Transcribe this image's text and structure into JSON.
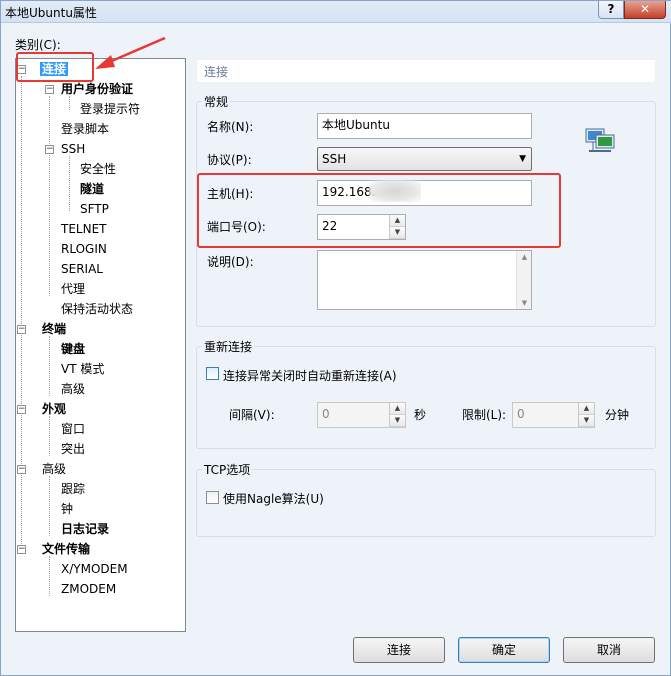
{
  "window": {
    "title": "本地Ubuntu属性",
    "help_label": "?",
    "close_label": "✕"
  },
  "category_label": "类别(C):",
  "tree": {
    "nodes": [
      {
        "label": "连接"
      },
      {
        "label": "用户身份验证"
      },
      {
        "label": "登录提示符"
      },
      {
        "label": "登录脚本"
      },
      {
        "label": "SSH"
      },
      {
        "label": "安全性"
      },
      {
        "label": "隧道"
      },
      {
        "label": "SFTP"
      },
      {
        "label": "TELNET"
      },
      {
        "label": "RLOGIN"
      },
      {
        "label": "SERIAL"
      },
      {
        "label": "代理"
      },
      {
        "label": "保持活动状态"
      },
      {
        "label": "终端"
      },
      {
        "label": "键盘"
      },
      {
        "label": "VT 模式"
      },
      {
        "label": "高级"
      },
      {
        "label": "外观"
      },
      {
        "label": "窗口"
      },
      {
        "label": "突出"
      },
      {
        "label": "高级"
      },
      {
        "label": "跟踪"
      },
      {
        "label": "钟"
      },
      {
        "label": "日志记录"
      },
      {
        "label": "文件传输"
      },
      {
        "label": "X/YMODEM"
      },
      {
        "label": "ZMODEM"
      }
    ]
  },
  "panel": {
    "title": "连接",
    "general": {
      "title": "常规",
      "name_label": "名称(N):",
      "name_value": "本地Ubuntu",
      "protocol_label": "协议(P):",
      "protocol_value": "SSH",
      "host_label": "主机(H):",
      "host_value": "192.168.",
      "port_label": "端口号(O):",
      "port_value": "22",
      "desc_label": "说明(D):"
    },
    "reconnect": {
      "title": "重新连接",
      "checkbox_label": "连接异常关闭时自动重新连接(A)",
      "interval_label": "间隔(V):",
      "interval_value": "0",
      "interval_unit": "秒",
      "limit_label": "限制(L):",
      "limit_value": "0",
      "limit_unit": "分钟"
    },
    "tcp": {
      "title": "TCP选项",
      "checkbox_label": "使用Nagle算法(U)"
    }
  },
  "buttons": {
    "connect": "连接",
    "ok": "确定",
    "cancel": "取消"
  },
  "colors": {
    "selection": "#3399ff",
    "annotation": "#e53935"
  }
}
